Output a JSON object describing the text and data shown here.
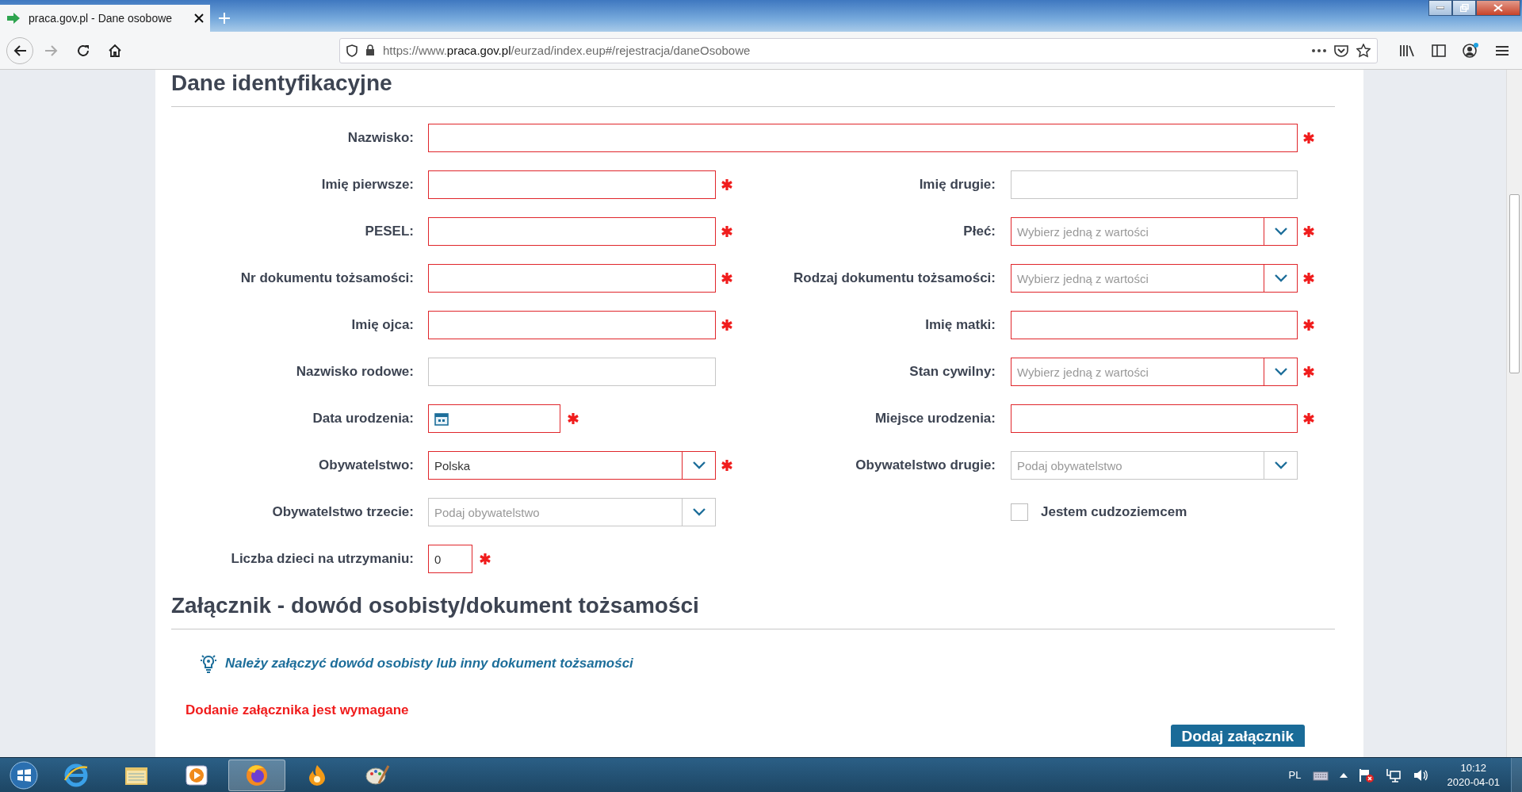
{
  "browser": {
    "tab": {
      "title": "praca.gov.pl - Dane osobowe",
      "selected": true
    },
    "url": "https://www.**praca.gov.pl**/eurzad/index.eup#/rejestracja/daneOsobowe"
  },
  "sections": [
    {
      "title": "Dane identyfikacyjne",
      "rows": [
        {
          "fields": [
            {
              "kind": "text",
              "label": "Nazwisko:",
              "required": true,
              "wide": true
            }
          ]
        },
        {
          "fields": [
            {
              "kind": "text",
              "label": "Imię pierwsze:",
              "required": true
            },
            {
              "kind": "text",
              "label": "Imię drugie:",
              "required": false
            }
          ]
        },
        {
          "fields": [
            {
              "kind": "text",
              "label": "PESEL:",
              "required": true
            },
            {
              "kind": "select",
              "label": "Płeć:",
              "placeholder": "Wybierz jedną z wartości",
              "required": true
            }
          ]
        },
        {
          "fields": [
            {
              "kind": "text",
              "label": "Nr dokumentu tożsamości:",
              "required": true
            },
            {
              "kind": "select",
              "label": "Rodzaj dokumentu tożsamości:",
              "placeholder": "Wybierz jedną z wartości",
              "required": true
            }
          ]
        },
        {
          "fields": [
            {
              "kind": "text",
              "label": "Imię ojca:",
              "required": true
            },
            {
              "kind": "text",
              "label": "Imię matki:",
              "required": true
            }
          ]
        },
        {
          "fields": [
            {
              "kind": "text",
              "label": "Nazwisko rodowe:",
              "required": false
            },
            {
              "kind": "select",
              "label": "Stan cywilny:",
              "placeholder": "Wybierz jedną z wartości",
              "required": true
            }
          ]
        },
        {
          "fields": [
            {
              "kind": "date",
              "label": "Data urodzenia:",
              "required": true
            },
            {
              "kind": "text",
              "label": "Miejsce urodzenia:",
              "required": true
            }
          ]
        },
        {
          "fields": [
            {
              "kind": "select",
              "label": "Obywatelstwo:",
              "value": "Polska",
              "required": true
            },
            {
              "kind": "select",
              "label": "Obywatelstwo drugie:",
              "placeholder": "Podaj obywatelstwo",
              "required": false
            }
          ]
        },
        {
          "fields": [
            {
              "kind": "select",
              "label": "Obywatelstwo trzecie:",
              "placeholder": "Podaj obywatelstwo",
              "required": false
            },
            {
              "kind": "checkbox",
              "label": "Jestem cudzoziemcem",
              "checked": false
            }
          ]
        },
        {
          "fields": [
            {
              "kind": "number",
              "label": "Liczba dzieci na utrzymaniu:",
              "value": "0",
              "required": true
            }
          ]
        }
      ]
    },
    {
      "title": "Załącznik - dowód osobisty/dokument tożsamości",
      "hint": "Należy załączyć dowód osobisty lub inny dokument tożsamości",
      "error": "Dodanie załącznika jest wymagane",
      "button": "Dodaj załącznik"
    }
  ],
  "taskbar": {
    "apps": [
      {
        "kind": "ie",
        "active": false
      },
      {
        "kind": "explorer",
        "active": false
      },
      {
        "kind": "media",
        "active": false
      },
      {
        "kind": "firefox",
        "active": true
      },
      {
        "kind": "flame",
        "active": false
      },
      {
        "kind": "paint",
        "active": false
      }
    ],
    "language": "PL",
    "time": "10:12",
    "date": "2020-04-01"
  }
}
